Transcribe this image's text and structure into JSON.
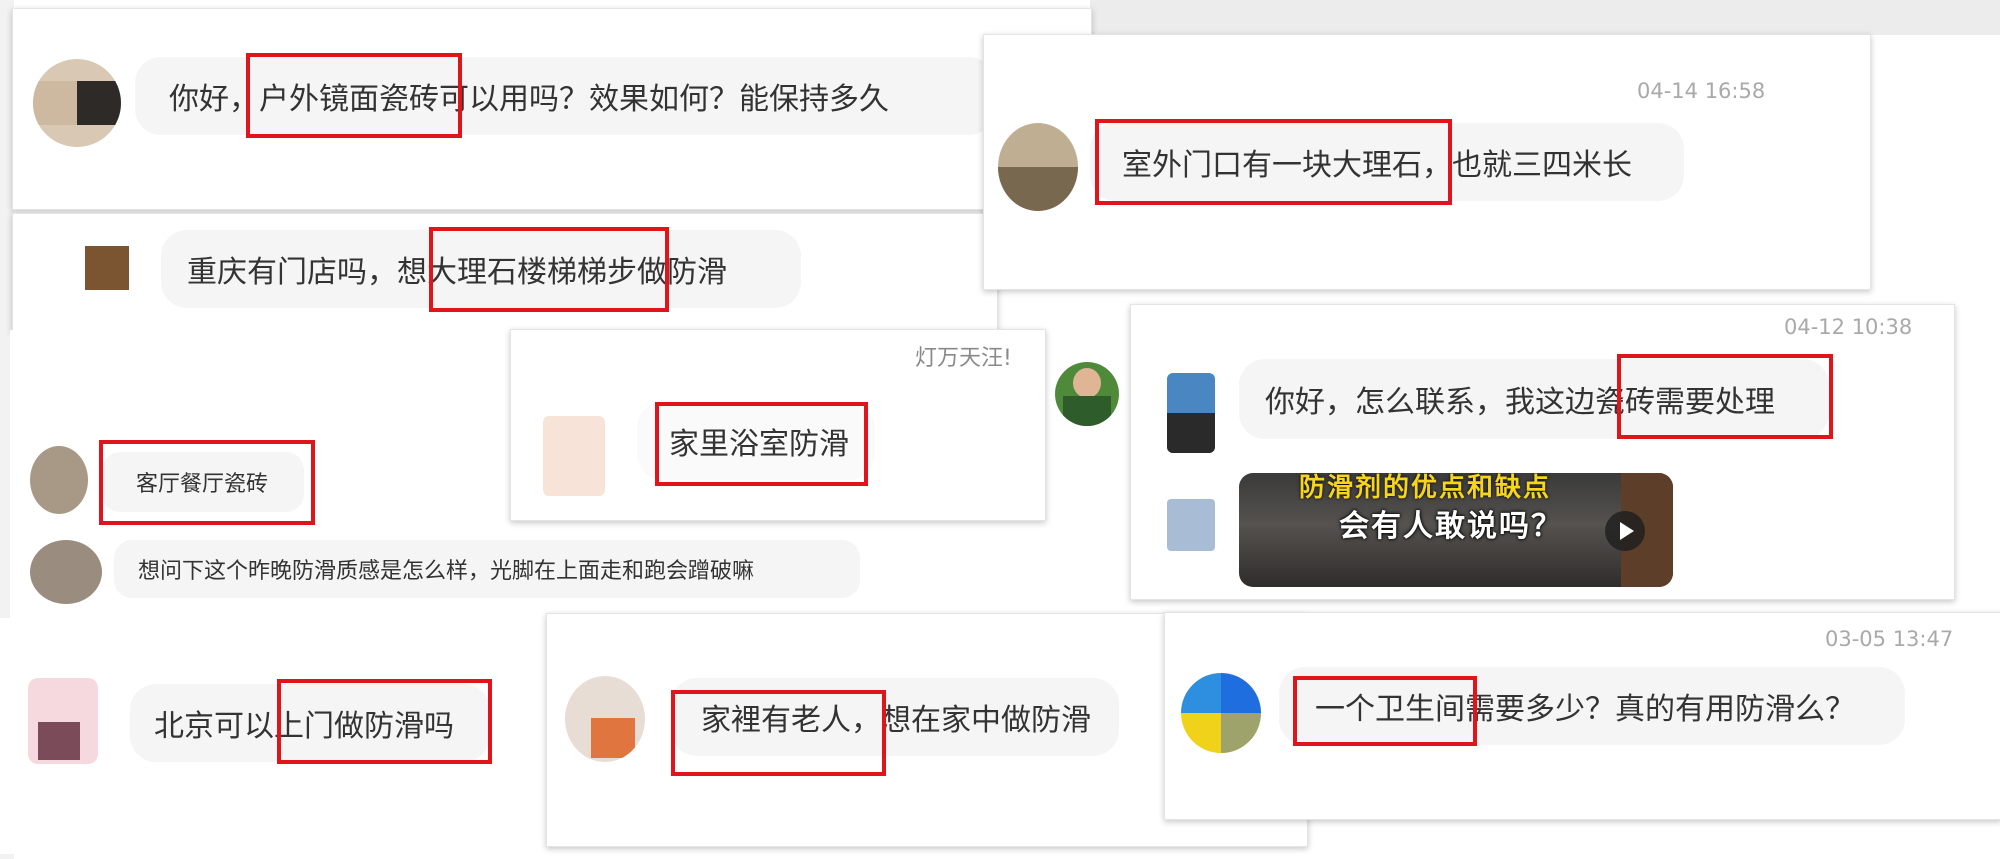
{
  "messages": {
    "m1": "你好，户外镜面瓷砖可以用吗？效果如何？能保持多久",
    "m2": "重庆有门店吗，想大理石楼梯梯步做防滑",
    "m3": "室外门口有一块大理石，也就三四米长",
    "m4": "客厅餐厅瓷砖",
    "m5": "家里浴室防滑",
    "m6": "想问下这个昨晚防滑质感是怎么样，光脚在上面走和跑会蹭破嘛",
    "m7": "你好，怎么联系，我这边瓷砖需要处理",
    "m8": "北京可以上门做防滑吗",
    "m9": "家裡有老人，想在家中做防滑",
    "m10": "一个卫生间需要多少？真的有用防滑么？"
  },
  "timestamps": {
    "t1": "04-14 16:58",
    "t2": "04-12 10:38",
    "t3": "03-05 13:47"
  },
  "partial_text": "灯万天汪!",
  "video": {
    "caption_top": "防滑剂的优点和缺点",
    "caption": "会有人敢说吗？"
  },
  "colors": {
    "highlight": "#e0141b",
    "bubble": "#f5f5f5",
    "timestamp": "#a9a9a9"
  },
  "icons": {
    "play": "play-icon"
  }
}
